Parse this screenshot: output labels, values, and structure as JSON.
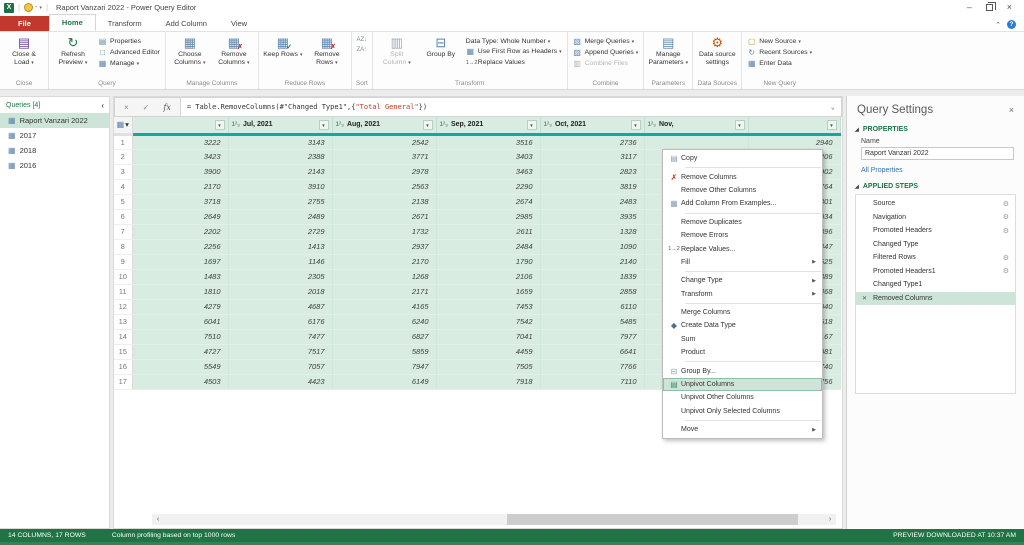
{
  "window": {
    "title": "Raport Vanzari 2022 - Power Query Editor"
  },
  "tabs": {
    "file": "File",
    "home": "Home",
    "transform": "Transform",
    "add_column": "Add Column",
    "view": "View"
  },
  "ribbon": {
    "close": {
      "label": "Close",
      "close_load": "Close & Load"
    },
    "query": {
      "label": "Query",
      "refresh": "Refresh Preview",
      "properties": "Properties",
      "advanced": "Advanced Editor",
      "manage": "Manage"
    },
    "manage_columns": {
      "label": "Manage Columns",
      "choose": "Choose Columns",
      "remove": "Remove Columns"
    },
    "reduce_rows": {
      "label": "Reduce Rows",
      "keep": "Keep Rows",
      "remove": "Remove Rows"
    },
    "sort": {
      "label": "Sort"
    },
    "transform": {
      "label": "Transform",
      "split": "Split Column",
      "group_by": "Group By",
      "data_type": "Data Type: Whole Number",
      "first_row": "Use First Row as Headers",
      "replace": "Replace Values"
    },
    "combine": {
      "label": "Combine",
      "merge": "Merge Queries",
      "append": "Append Queries",
      "files": "Combine Files"
    },
    "parameters": {
      "label": "Parameters",
      "manage": "Manage Parameters"
    },
    "data_sources": {
      "label": "Data Sources",
      "settings": "Data source settings"
    },
    "new_query": {
      "label": "New Query",
      "new_source": "New Source",
      "recent": "Recent Sources",
      "enter": "Enter Data"
    }
  },
  "formula": {
    "part1": "= Table.RemoveColumns(#\"Changed Type1\",{",
    "part2": "\"Total General\"",
    "part3": "})"
  },
  "queries": {
    "header": "Queries [4]",
    "items": [
      {
        "label": "Raport Vanzari 2022",
        "selected": true
      },
      {
        "label": "2017",
        "selected": false
      },
      {
        "label": "2018",
        "selected": false
      },
      {
        "label": "2016",
        "selected": false
      }
    ]
  },
  "table": {
    "type_icon_glyph": "1²₃",
    "columns": [
      {
        "header": "",
        "typed": false,
        "values": [
          3222,
          3423,
          3900,
          2170,
          3718,
          2649,
          2202,
          2256,
          1697,
          1483,
          1810,
          4279,
          6041,
          7510,
          4727,
          5549,
          4503
        ]
      },
      {
        "header": "Jul, 2021",
        "typed": true,
        "values": [
          3143,
          2388,
          2143,
          3910,
          2755,
          2489,
          2729,
          1413,
          1146,
          2305,
          2018,
          4687,
          6176,
          7477,
          7517,
          7057,
          4423
        ]
      },
      {
        "header": "Aug, 2021",
        "typed": true,
        "values": [
          2542,
          3771,
          2978,
          2563,
          2138,
          2671,
          1732,
          2937,
          2170,
          1268,
          2171,
          4165,
          6240,
          6827,
          5859,
          7947,
          6149
        ]
      },
      {
        "header": "Sep, 2021",
        "typed": true,
        "values": [
          3516,
          3403,
          3463,
          2290,
          2674,
          2985,
          2611,
          2484,
          1790,
          2106,
          1659,
          7453,
          7542,
          7041,
          4459,
          7505,
          7918
        ]
      },
      {
        "header": "Oct, 2021",
        "typed": true,
        "values": [
          2736,
          3117,
          2823,
          3819,
          2483,
          3935,
          1328,
          1090,
          2140,
          1839,
          2858,
          6110,
          5485,
          7977,
          6641,
          7766,
          7110
        ]
      },
      {
        "header": "Nov,",
        "typed": true,
        "values": [
          null,
          null,
          null,
          null,
          null,
          null,
          null,
          null,
          null,
          null,
          null,
          null,
          null,
          null,
          null,
          null,
          null
        ]
      },
      {
        "header": "",
        "typed": false,
        "values": [
          2940,
          3206,
          2902,
          3764,
          3301,
          2034,
          1896,
          2447,
          1625,
          2389,
          1468,
          6040,
          5518,
          5167,
          4081,
          6740,
          7756
        ]
      }
    ]
  },
  "context_menu": {
    "items": [
      {
        "label": "Copy",
        "icon": "copy"
      },
      {
        "sep": true
      },
      {
        "label": "Remove Columns",
        "icon": "remove-columns"
      },
      {
        "label": "Remove Other Columns"
      },
      {
        "label": "Add Column From Examples...",
        "icon": "add-column-from-examples"
      },
      {
        "sep": true
      },
      {
        "label": "Remove Duplicates"
      },
      {
        "label": "Remove Errors"
      },
      {
        "label": "Replace Values...",
        "icon": "replace-values"
      },
      {
        "label": "Fill",
        "submenu": true
      },
      {
        "sep": true
      },
      {
        "label": "Change Type",
        "submenu": true
      },
      {
        "label": "Transform",
        "submenu": true
      },
      {
        "sep": true
      },
      {
        "label": "Merge Columns"
      },
      {
        "label": "Create Data Type",
        "icon": "create-data-type"
      },
      {
        "label": "Sum"
      },
      {
        "label": "Product"
      },
      {
        "sep": true
      },
      {
        "label": "Group By...",
        "icon": "group-by"
      },
      {
        "label": "Unpivot Columns",
        "icon": "unpivot-columns",
        "highlighted": true
      },
      {
        "label": "Unpivot Other Columns"
      },
      {
        "label": "Unpivot Only Selected Columns"
      },
      {
        "sep": true
      },
      {
        "label": "Move",
        "submenu": true
      }
    ]
  },
  "settings": {
    "title": "Query Settings",
    "properties_label": "PROPERTIES",
    "name_label": "Name",
    "name_value": "Raport Vanzari 2022",
    "all_properties": "All Properties",
    "steps_label": "APPLIED STEPS",
    "steps": [
      {
        "label": "Source",
        "gear": true
      },
      {
        "label": "Navigation",
        "gear": true
      },
      {
        "label": "Promoted Headers",
        "gear": true
      },
      {
        "label": "Changed Type",
        "gear": false
      },
      {
        "label": "Filtered Rows",
        "gear": true
      },
      {
        "label": "Promoted Headers1",
        "gear": true
      },
      {
        "label": "Changed Type1",
        "gear": false
      },
      {
        "label": "Removed Columns",
        "gear": false,
        "selected": true
      }
    ]
  },
  "statusbar": {
    "columns_rows": "14 COLUMNS, 17 ROWS",
    "profiling": "Column profiling based on top 1000 rows",
    "preview": "PREVIEW DOWNLOADED AT 10:37 AM"
  },
  "colors": {
    "excel_green": "#217346",
    "selection_teal": "#14a79a",
    "selected_cell_bg": "#d9ece2",
    "file_tab_red": "#c0392b"
  }
}
